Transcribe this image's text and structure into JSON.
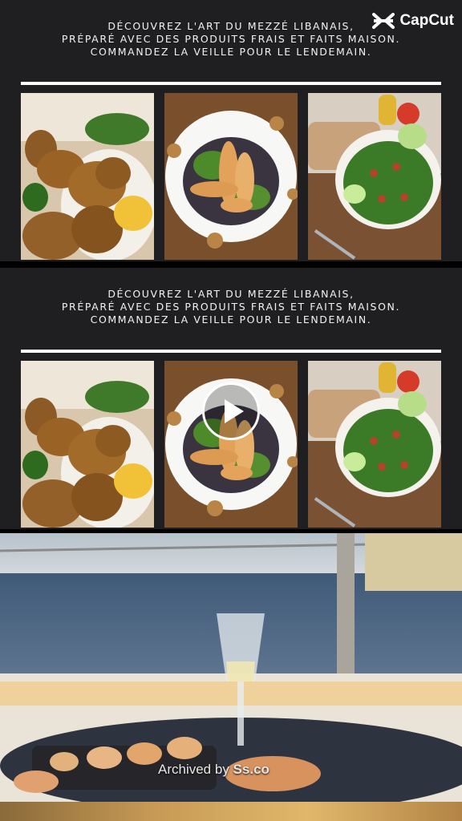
{
  "promo": {
    "line1": "DÉCOUVREZ L'ART DU MEZZÉ LIBANAIS,",
    "line2": "PRÉPARÉ AVEC DES PRODUITS FRAIS ET FAITS MAISON.",
    "line3": "COMMANDEZ LA VEILLE POUR LE LENDEMAIN."
  },
  "watermark": {
    "brand": "CapCut"
  },
  "archive": {
    "prefix": "Archived by ",
    "name": "Ss.co"
  },
  "icons": {
    "logo": "capcut-logo-icon",
    "play": "play-icon"
  },
  "colors": {
    "panel": "#1f1f22",
    "rule": "#ffffff",
    "text": "#f2f2f2"
  }
}
